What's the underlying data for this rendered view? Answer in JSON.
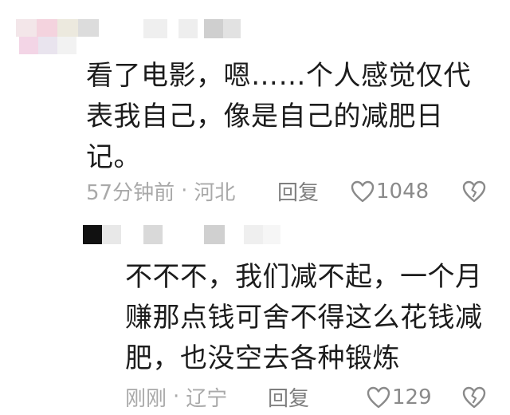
{
  "comments": [
    {
      "text_lines": [
        "看了电影，嗯……个人感觉仅代",
        "表我自己，像是自己的减肥日",
        "记。"
      ],
      "time": "57分钟前",
      "separator": "·",
      "location": "河北",
      "reply_label": "回复",
      "likes": "1048"
    },
    {
      "text_lines": [
        "不不不，我们减不起，一个月",
        "赚那点钱可舍不得这么花钱减",
        "肥，也没空去各种锻炼"
      ],
      "time": "刚刚",
      "separator": "·",
      "location": "辽宁",
      "reply_label": "回复",
      "likes": "129"
    }
  ],
  "colors": {
    "text": "#1c1c1c",
    "meta": "#a9a9a9",
    "icon": "#8a8a8a"
  },
  "icons": [
    "heart-icon",
    "broken-heart-icon"
  ]
}
